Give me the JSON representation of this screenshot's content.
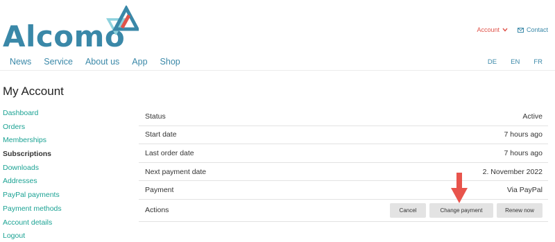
{
  "brand": {
    "name": "Alcomo"
  },
  "header": {
    "account_label": "Account",
    "contact_label": "Contact",
    "nav": [
      {
        "label": "News"
      },
      {
        "label": "Service"
      },
      {
        "label": "About us"
      },
      {
        "label": "App"
      },
      {
        "label": "Shop"
      }
    ],
    "languages": [
      "DE",
      "EN",
      "FR"
    ]
  },
  "page": {
    "title": "My Account"
  },
  "sidebar": {
    "items": [
      {
        "label": "Dashboard"
      },
      {
        "label": "Orders"
      },
      {
        "label": "Memberships"
      },
      {
        "label": "Subscriptions",
        "active": true
      },
      {
        "label": "Downloads"
      },
      {
        "label": "Addresses"
      },
      {
        "label": "PayPal payments"
      },
      {
        "label": "Payment methods"
      },
      {
        "label": "Account details"
      },
      {
        "label": "Logout"
      }
    ]
  },
  "subscription": {
    "rows": [
      {
        "label": "Status",
        "value": "Active"
      },
      {
        "label": "Start date",
        "value": "7 hours ago"
      },
      {
        "label": "Last order date",
        "value": "7 hours ago"
      },
      {
        "label": "Next payment date",
        "value": "2. November 2022"
      },
      {
        "label": "Payment",
        "value": "Via PayPal"
      }
    ],
    "actions_label": "Actions",
    "buttons": {
      "cancel": "Cancel",
      "change_payment": "Change payment",
      "renew": "Renew now"
    }
  },
  "colors": {
    "brand_blue": "#3a88a8",
    "accent_red": "#e0534a",
    "link_teal": "#1aa293",
    "button_gray": "#e3e3e3"
  },
  "icons": {
    "logo_mark": "triangle-logo-icon",
    "account_dropdown": "chevron-down-icon",
    "contact": "envelope-icon",
    "annotation": "red-down-arrow-icon"
  }
}
